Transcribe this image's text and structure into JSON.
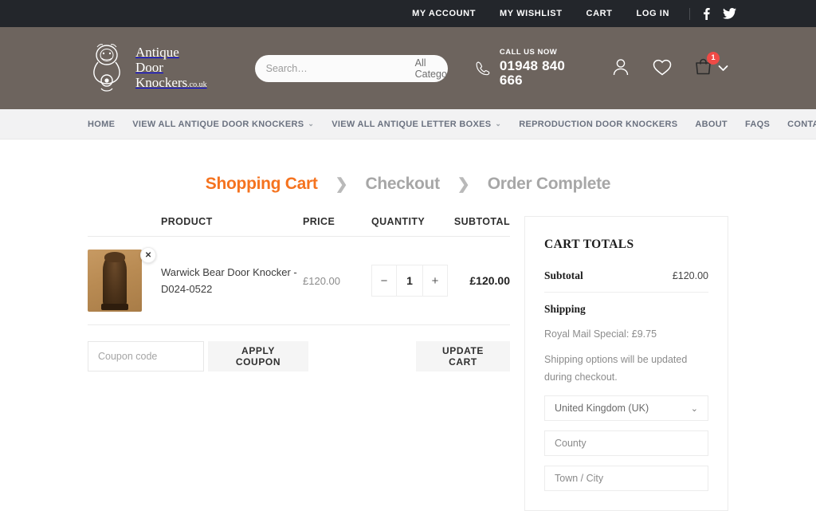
{
  "topbar": {
    "links": [
      "MY ACCOUNT",
      "MY WISHLIST",
      "CART",
      "LOG IN"
    ],
    "social": [
      {
        "name": "facebook-icon",
        "label": "f"
      },
      {
        "name": "twitter-icon",
        "label": "Twitter"
      }
    ]
  },
  "header": {
    "logo": {
      "line1": "Antique",
      "line2": "Door",
      "line3": "Knockers",
      "domain": ".co.uk",
      "icon": "lion-door-knocker-icon"
    },
    "search": {
      "placeholder": "Search…",
      "value": "",
      "category": "All Categories",
      "button_icon": "search-icon"
    },
    "call": {
      "label": "CALL US NOW",
      "number": "01948 840 666",
      "icon": "phone-icon"
    },
    "icons": {
      "account": "user-icon",
      "wishlist": "heart-icon",
      "cart": "shopping-bag-icon",
      "cart_count": "1",
      "cart_chevron": "chevron-down-icon"
    }
  },
  "nav": {
    "items": [
      {
        "label": "HOME",
        "caret": false
      },
      {
        "label": "VIEW ALL ANTIQUE DOOR KNOCKERS",
        "caret": true
      },
      {
        "label": "VIEW ALL ANTIQUE LETTER BOXES",
        "caret": true
      },
      {
        "label": "REPRODUCTION DOOR KNOCKERS",
        "caret": false
      },
      {
        "label": "ABOUT",
        "caret": false
      },
      {
        "label": "FAQS",
        "caret": false
      },
      {
        "label": "CONTACT US",
        "caret": false
      }
    ]
  },
  "steps": {
    "items": [
      "Shopping Cart",
      "Checkout",
      "Order Complete"
    ],
    "active_index": 0,
    "separator": "❯",
    "active_color": "#f5731f",
    "inactive_color": "#a7a7a7"
  },
  "cart": {
    "columns": [
      "PRODUCT",
      "PRICE",
      "QUANTITY",
      "SUBTOTAL"
    ],
    "rows": [
      {
        "name": "Warwick Bear Door Knocker - D024-0522",
        "price": "£120.00",
        "quantity": "1",
        "subtotal": "£120.00",
        "remove_label": "✕",
        "minus_label": "−",
        "plus_label": "+",
        "thumbnail_alt": "Warwick Bear Door Knocker photograph"
      }
    ],
    "coupon": {
      "placeholder": "Coupon code",
      "value": "",
      "apply_label": "APPLY COUPON"
    },
    "update_label": "UPDATE CART"
  },
  "totals": {
    "title": "CART TOTALS",
    "subtotal_label": "Subtotal",
    "subtotal_value": "£120.00",
    "shipping_label": "Shipping",
    "shipping_method": "Royal Mail Special: £9.75",
    "shipping_note": "Shipping options will be updated during checkout.",
    "country": "United Kingdom (UK)",
    "country_chevron": "chevron-down-icon",
    "county_placeholder": "County",
    "town_placeholder": "Town / City"
  }
}
